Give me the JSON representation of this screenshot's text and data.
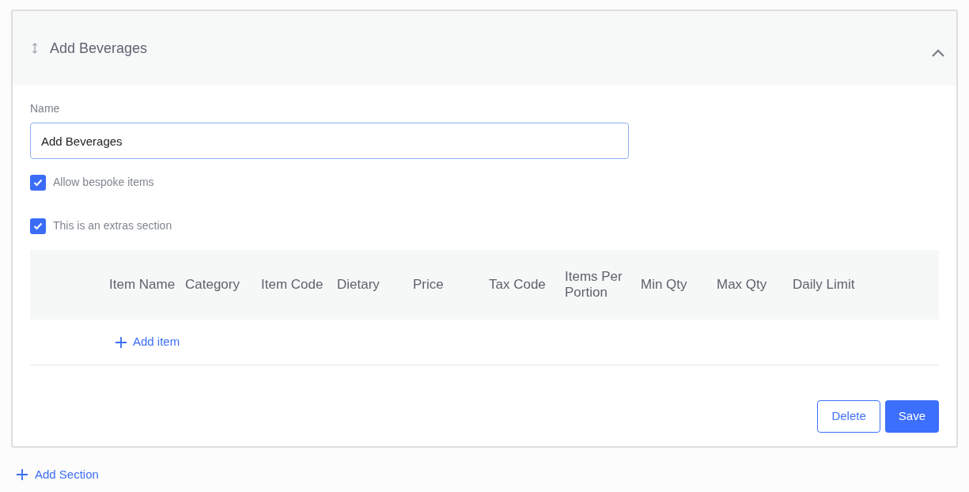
{
  "section": {
    "title": "Add Beverages",
    "expanded": true,
    "name_field": {
      "label": "Name",
      "value": "Add Beverages"
    },
    "options": [
      {
        "label": "Allow bespoke items",
        "checked": true
      },
      {
        "label": "This is an extras section",
        "checked": true
      }
    ],
    "table": {
      "columns": [
        "Item Name",
        "Category",
        "Item Code",
        "Dietary",
        "Price",
        "Tax Code",
        "Items Per Portion",
        "Min Qty",
        "Max Qty",
        "Daily Limit"
      ]
    },
    "add_item": "Add item",
    "buttons": [
      {
        "label": "Delete",
        "kind": "outline"
      },
      {
        "label": "Save",
        "kind": "primary"
      }
    ]
  },
  "add_section": "Add Section"
}
